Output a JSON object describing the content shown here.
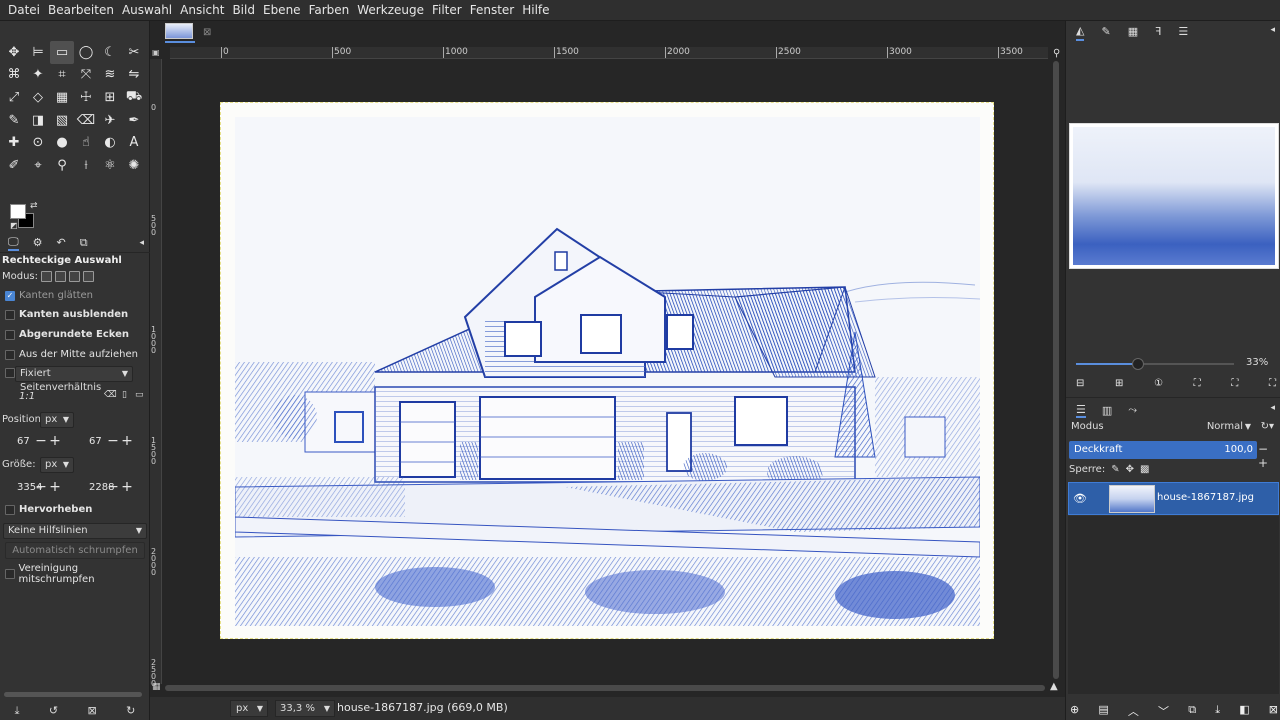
{
  "menubar": [
    "Datei",
    "Bearbeiten",
    "Auswahl",
    "Ansicht",
    "Bild",
    "Ebene",
    "Farben",
    "Werkzeuge",
    "Filter",
    "Fenster",
    "Hilfe"
  ],
  "toolbox": {
    "icons": [
      "move-icon",
      "align-icon",
      "rect-select-icon",
      "ellipse-select-icon",
      "lasso-icon",
      "scissors-icon",
      "fuzzy-select-icon",
      "wand-icon",
      "crop-icon",
      "transform-icon",
      "warp-icon",
      "flip-icon",
      "scale-icon",
      "perspective-icon",
      "cage-icon",
      "handle-icon",
      "unified-transform-icon",
      "bucket-icon",
      "paint-icon",
      "blend-icon",
      "gradient-icon",
      "eraser-icon",
      "airbrush-icon",
      "ink-icon",
      "heal-icon",
      "clone-icon",
      "blur-icon",
      "smudge-icon",
      "dodge-icon",
      "text-icon",
      "color-picker-icon",
      "paths-icon",
      "zoom-icon",
      "measure-icon",
      "gegl-icon",
      "extra-icon"
    ],
    "glyphs": [
      "✥",
      "⊨",
      "▭",
      "◯",
      "☾",
      "✂",
      "⌘",
      "✦",
      "⌗",
      "⤧",
      "≋",
      "⇋",
      "⤢",
      "◇",
      "▦",
      "☩",
      "⊞",
      "⛟",
      "✎",
      "◨",
      "▧",
      "⌫",
      "✈",
      "✒",
      "✚",
      "⊙",
      "●",
      "☝",
      "◐",
      "A",
      "✐",
      "⌖",
      "⚲",
      "⟊",
      "⚛",
      "✺"
    ]
  },
  "tool_options": {
    "tabs": [
      "🖵",
      "⚙",
      "↶",
      "⧉"
    ],
    "title": "Rechteckige Auswahl",
    "modus_label": "Modus:",
    "kanten_glaetten": "Kanten glätten",
    "kanten_ausblenden": "Kanten ausblenden",
    "abgerundete_ecken": "Abgerundete Ecken",
    "aus_der_mitte": "Aus der Mitte aufziehen",
    "fixiert": "Fixiert Seitenverhältnis",
    "ratio": "1:1",
    "position_label": "Position:",
    "position_unit": "px",
    "pos_x": "67",
    "pos_y": "67",
    "groesse_label": "Größe:",
    "groesse_unit": "px",
    "size_w": "3354",
    "size_h": "2288",
    "hervorheben": "Hervorheben",
    "hilfslinien": "Keine Hilfslinien",
    "auto_shrink": "Automatisch schrumpfen",
    "vereinigung": "Vereinigung mitschrumpfen"
  },
  "ruler_h": [
    "0",
    "500",
    "1000",
    "1500",
    "2000",
    "2500",
    "3000",
    "3500"
  ],
  "ruler_v": [
    "0",
    "500",
    "1000",
    "1500",
    "2000",
    "2500"
  ],
  "status": {
    "unit": "px",
    "zoom": "33,3 %",
    "file": "house-1867187.jpg (669,0 MB)"
  },
  "navigator": {
    "zoom_pct": "33%"
  },
  "layers": {
    "modus_label": "Modus",
    "modus_value": "Normal",
    "opacity_label": "Deckkraft",
    "opacity_value": "100,0",
    "lock_label": "Sperre:",
    "layer_name": "house-1867187.jpg"
  },
  "colors": {
    "accent": "#5a8ede",
    "selected_layer": "#2e5fa8",
    "blueprint": "#2f55c4"
  }
}
